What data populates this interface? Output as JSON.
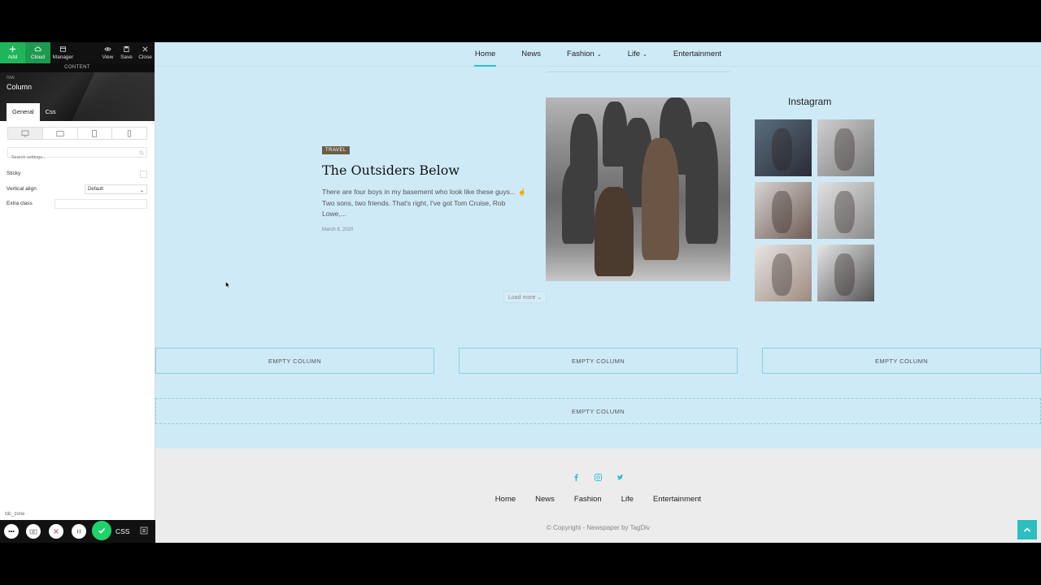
{
  "editor": {
    "toolbar": {
      "add": "Add",
      "cloud": "Cloud",
      "manager": "Manager",
      "view": "View",
      "save": "Save",
      "close": "Close"
    },
    "section_label": "CONTENT",
    "breadcrumb": "row",
    "element_title": "Column",
    "tabs": [
      "General",
      "Css"
    ],
    "search_placeholder": "Search settings...",
    "settings": {
      "sticky": "Sticky",
      "vertical_align": "Vertical align",
      "vertical_align_value": "Default",
      "extra_class": "Extra class"
    },
    "zone_label": "tdc_zone",
    "css_label": "CSS"
  },
  "site": {
    "nav": [
      "Home",
      "News",
      "Fashion",
      "Life",
      "Entertainment"
    ],
    "post": {
      "category": "TRAVEL",
      "title": "The Outsiders Below",
      "excerpt": "There are four boys in my basement who look like these guys... ☝ Two sons, two friends. That's right, I've got Tom Cruise, Rob Lowe,...",
      "date": "March 8, 2020"
    },
    "load_more": "Load more",
    "instagram_title": "Instagram",
    "empty_columns": [
      "EMPTY COLUMN",
      "EMPTY COLUMN",
      "EMPTY COLUMN",
      "EMPTY COLUMN"
    ],
    "footer": {
      "nav": [
        "Home",
        "News",
        "Fashion",
        "Life",
        "Entertainment"
      ],
      "copyright": "© Copyright - Newspaper by TagDiv",
      "social_icons": [
        "facebook-icon",
        "instagram-icon",
        "twitter-icon"
      ]
    }
  },
  "colors": {
    "accent": "#2fbfc9",
    "site_bg": "#cfeaf7",
    "footer_bg": "#ececec",
    "editor_green": "#20b55a"
  }
}
